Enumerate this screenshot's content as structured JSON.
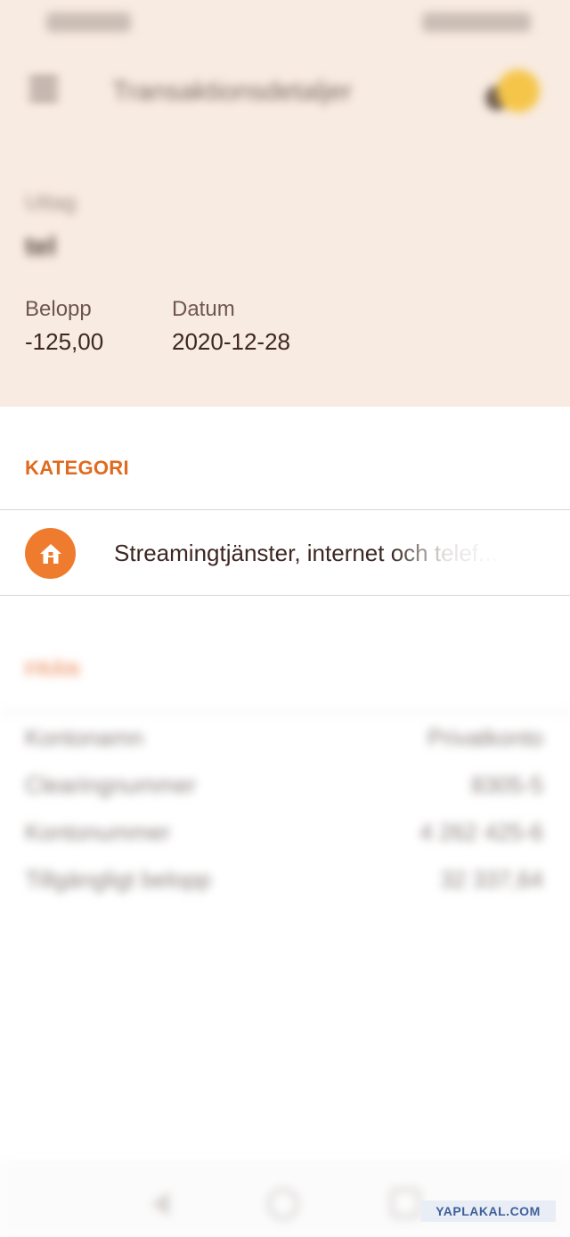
{
  "status_bar": {
    "left": "",
    "right": ""
  },
  "app_bar": {
    "title": "Transaktionsdetaljer",
    "menu_icon": "menu-icon",
    "avatar_color": "#f5c54a"
  },
  "transaction": {
    "description_label": "Uttag",
    "description_value": "tel",
    "amount_label": "Belopp",
    "amount_value": "-125,00",
    "date_label": "Datum",
    "date_value": "2020-12-28"
  },
  "category": {
    "section_title": "KATEGORI",
    "icon": "home-icon",
    "icon_color": "#ef7c2e",
    "label": "Streamingtjänster, internet och telef..."
  },
  "from": {
    "section_title": "FRÅN",
    "rows": [
      {
        "label": "Kontonamn",
        "value": "Privatkonto"
      },
      {
        "label": "Clearingnummer",
        "value": "8305-5"
      },
      {
        "label": "Kontonummer",
        "value": "4 262 425-6"
      },
      {
        "label": "Tillgängligt belopp",
        "value": "32 337,64"
      }
    ]
  },
  "watermark": "YAPLAKAL.COM",
  "colors": {
    "accent": "#e06a1e",
    "header_bg": "#f8ebe1"
  }
}
